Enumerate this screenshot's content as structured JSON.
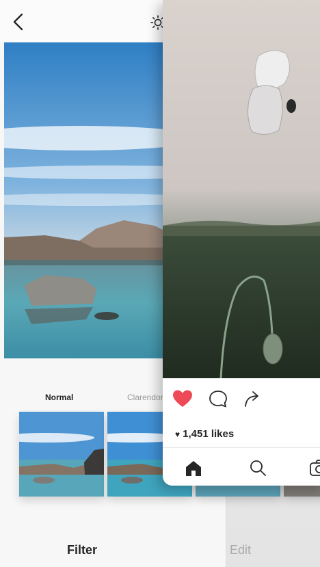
{
  "editor": {
    "filters": [
      {
        "name": "Normal",
        "selected": true
      },
      {
        "name": "Clarendon",
        "selected": false
      }
    ],
    "bottom_tabs": [
      {
        "label": "Filter",
        "active": true
      },
      {
        "label": "Edit",
        "active": false
      }
    ],
    "icons": [
      "back-chevron-icon",
      "sun-icon"
    ]
  },
  "post": {
    "likes_text": "1,451 likes",
    "liked": true,
    "icons": [
      "heart-icon",
      "comment-icon",
      "share-icon",
      "home-icon",
      "search-icon",
      "camera-icon"
    ]
  },
  "colors": {
    "like_red": "#ed4956",
    "text_dark": "#262626",
    "text_muted": "#999999"
  }
}
